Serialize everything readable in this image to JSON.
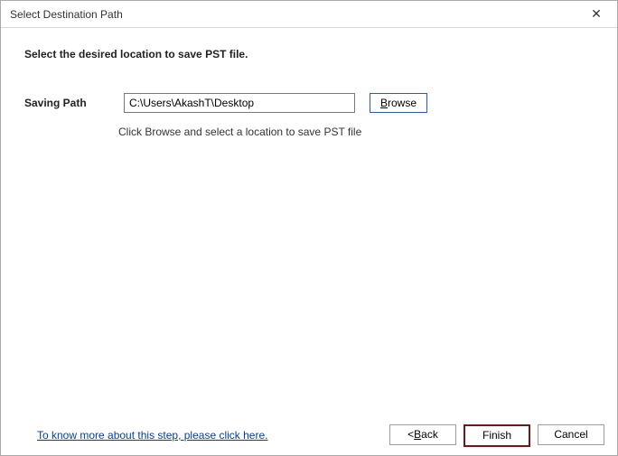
{
  "titlebar": {
    "title": "Select Destination Path",
    "close_symbol": "✕"
  },
  "main": {
    "heading": "Select the desired location to save PST file.",
    "path_label": "Saving Path",
    "path_value": "C:\\Users\\AkashT\\Desktop",
    "browse_prefix": "B",
    "browse_rest": "rowse",
    "hint": "Click Browse and select a location to save PST file"
  },
  "footer": {
    "help_link": "To know more about this step, please click here.",
    "back_prefix": "< ",
    "back_u": "B",
    "back_rest": "ack",
    "finish_label": "Finish",
    "cancel_label": "Cancel"
  }
}
